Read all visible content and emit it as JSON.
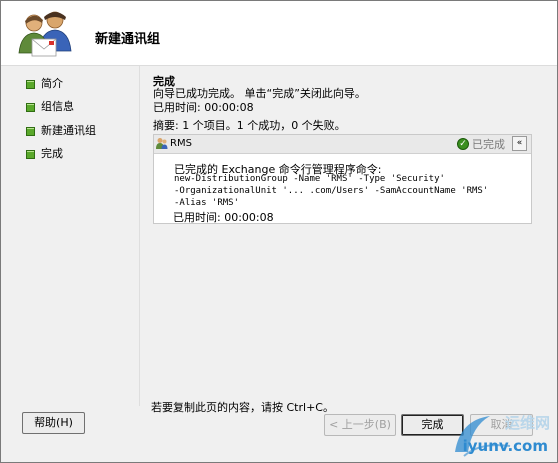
{
  "window": {
    "title": "新建通讯组"
  },
  "sidebar": {
    "items": [
      {
        "label": "简介"
      },
      {
        "label": "组信息"
      },
      {
        "label": "新建通讯组"
      },
      {
        "label": "完成"
      }
    ]
  },
  "main": {
    "section_title": "完成",
    "message": "向导已成功完成。 单击“完成”关闭此向导。",
    "elapsed": "已用时间: 00:00:08",
    "summary": "摘要: 1 个项目。1 个成功，0 个失败。",
    "result": {
      "name": "RMS",
      "status": "已完成",
      "collapse_glyph": "«",
      "completed_label": "已完成的 Exchange 命令行管理程序命令:",
      "command_lines": [
        "new-DistributionGroup -Name 'RMS' -Type 'Security'",
        "-OrganizationalUnit '... .com/Users' -SamAccountName 'RMS'",
        "-Alias 'RMS'"
      ],
      "elapsed": "已用时间: 00:00:08"
    },
    "copy_hint": "若要复制此页的内容，请按 Ctrl+C。"
  },
  "buttons": {
    "help": "帮助(H)",
    "back": "< 上一步(B)",
    "finish": "完成",
    "cancel": "取消"
  },
  "watermark": {
    "line1": "运维网",
    "line2": "iyunv.com"
  },
  "colors": {
    "accent_green": "#5aa82b",
    "status_check": "#3a8f1f",
    "watermark_blue": "#2f8bd0"
  }
}
